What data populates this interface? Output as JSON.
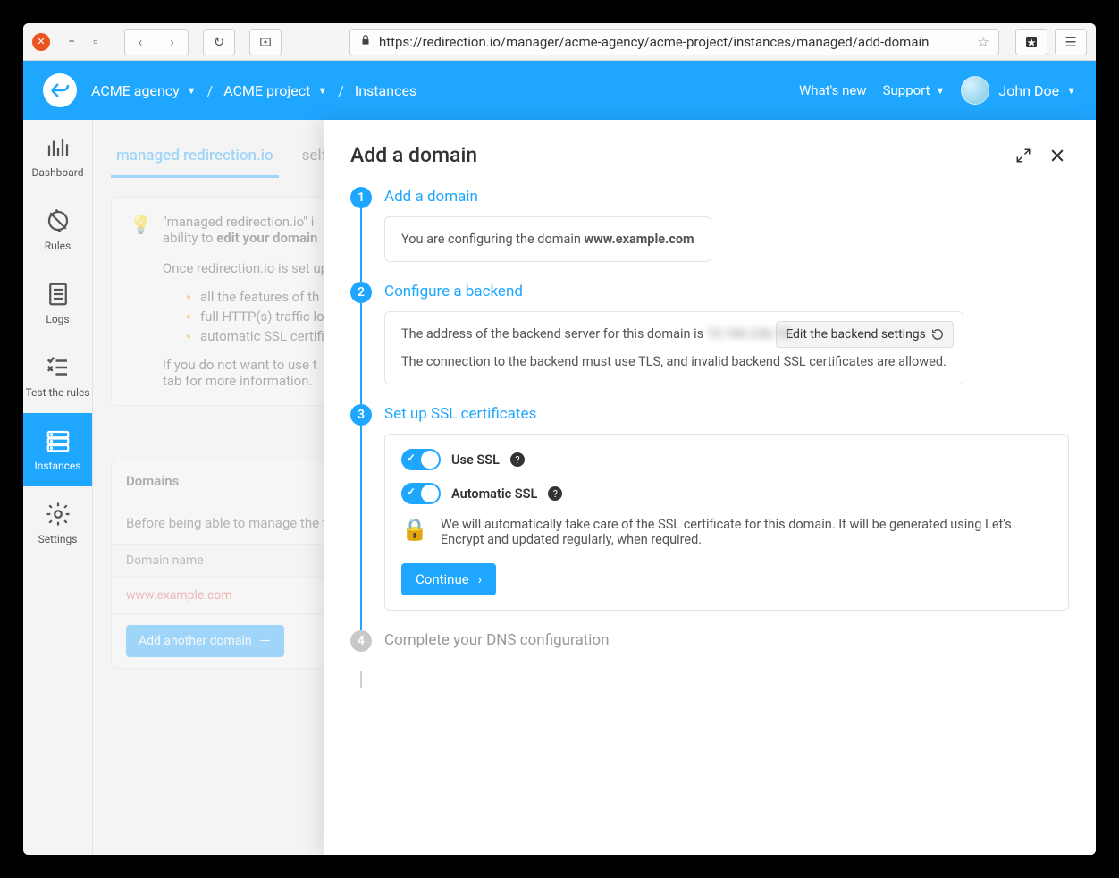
{
  "browser": {
    "url": "https://redirection.io/manager/acme-agency/acme-project/instances/managed/add-domain"
  },
  "header": {
    "breadcrumb": {
      "agency": "ACME agency",
      "project": "ACME project",
      "section": "Instances"
    },
    "whats_new": "What's new",
    "support": "Support",
    "user": "John Doe"
  },
  "leftnav": {
    "dashboard": "Dashboard",
    "rules": "Rules",
    "logs": "Logs",
    "test": "Test the rules",
    "instances": "Instances",
    "settings": "Settings"
  },
  "content": {
    "tab_managed": "managed redirection.io",
    "tab_self": "self",
    "info_line1_a": "\"managed redirection.io\" i",
    "info_line1_b": "ability to ",
    "info_line1_bold": "edit your domain",
    "info_line2": "Once redirection.io is set up",
    "info_b1": "all the features of th",
    "info_b2": "full HTTP(s) traffic lo",
    "info_b3": "automatic SSL certifi",
    "info_line3": "If you do not want to use t",
    "info_line4": "tab for more information.",
    "domains_title": "Domains",
    "domains_note": "Before being able to manage the tr",
    "domains_col": "Domain name",
    "domain_value": "www.example.com",
    "add_domain_btn": "Add another domain"
  },
  "panel": {
    "title": "Add a domain",
    "step1": {
      "title": "Add a domain",
      "body_prefix": "You are configuring the domain ",
      "body_domain": "www.example.com"
    },
    "step2": {
      "title": "Configure a backend",
      "line1_prefix": "The address of the backend server for this domain is ",
      "ip": "10.184.236.14",
      "line2": "The connection to the backend must use TLS, and invalid backend SSL certificates are allowed.",
      "edit_btn": "Edit the backend settings"
    },
    "step3": {
      "title": "Set up SSL certificates",
      "use_ssl": "Use SSL",
      "auto_ssl": "Automatic SSL",
      "note": "We will automatically take care of the SSL certificate for this domain. It will be generated using Let's Encrypt and updated regularly, when required.",
      "continue": "Continue"
    },
    "step4": {
      "title": "Complete your DNS configuration"
    }
  }
}
